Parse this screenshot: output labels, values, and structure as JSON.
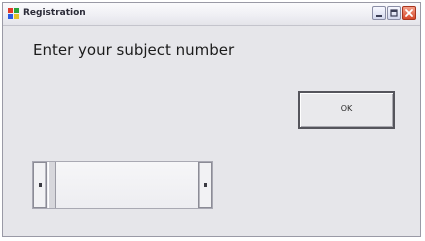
{
  "window": {
    "title": "Registration",
    "controls": {
      "minimize_icon": "minimize-icon",
      "maximize_icon": "maximize-icon",
      "close_icon": "close-icon"
    }
  },
  "form": {
    "prompt": "Enter your subject number",
    "ok_label": "OK",
    "scrollbar": {
      "left_arrow": "left-arrow-icon",
      "right_arrow": "right-arrow-icon"
    }
  },
  "colors": {
    "window_bg": "#e6e6ea",
    "close_button": "#d6482a"
  }
}
